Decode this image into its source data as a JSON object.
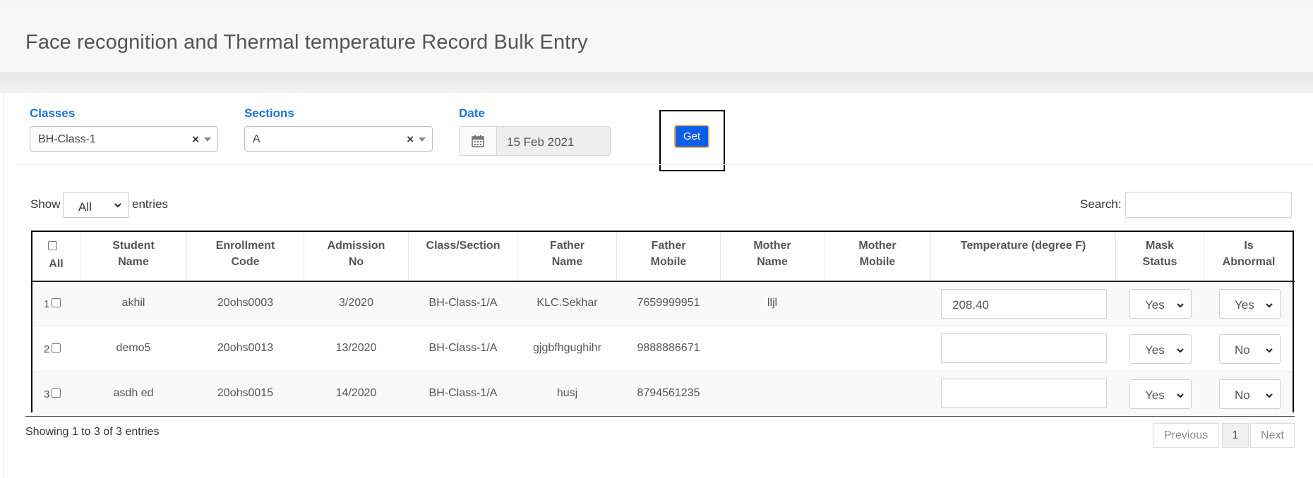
{
  "page": {
    "title": "Face recognition and Thermal temperature Record Bulk Entry"
  },
  "filters": {
    "classes": {
      "label": "Classes",
      "value": "BH-Class-1",
      "clear": "×"
    },
    "sections": {
      "label": "Sections",
      "value": "A",
      "clear": "×"
    },
    "date": {
      "label": "Date",
      "value": "15 Feb 2021"
    },
    "get_label": "Get"
  },
  "table_controls": {
    "show_label": "Show",
    "entries_value": "All",
    "entries_label": "entries",
    "search_label": "Search:",
    "search_value": ""
  },
  "columns": {
    "all": "All",
    "student_name": [
      "Student",
      "Name"
    ],
    "enrollment_code": [
      "Enrollment",
      "Code"
    ],
    "admission_no": [
      "Admission",
      "No"
    ],
    "class_section": "Class/Section",
    "father_name": [
      "Father",
      "Name"
    ],
    "father_mobile": [
      "Father",
      "Mobile"
    ],
    "mother_name": [
      "Mother",
      "Name"
    ],
    "mother_mobile": [
      "Mother",
      "Mobile"
    ],
    "temperature": "Temperature (degree F)",
    "mask_status": [
      "Mask",
      "Status"
    ],
    "is_abnormal": [
      "Is",
      "Abnormal"
    ]
  },
  "rows": [
    {
      "num": "1",
      "student_name": "akhil",
      "enrollment_code": "20ohs0003",
      "admission_no": "3/2020",
      "class_section": "BH-Class-1/A",
      "father_name": "KLC.Sekhar",
      "father_mobile": "7659999951",
      "mother_name": "lljl",
      "mother_mobile": "",
      "temperature": "208.40",
      "mask_status": "Yes",
      "is_abnormal": "Yes"
    },
    {
      "num": "2",
      "student_name": "demo5",
      "enrollment_code": "20ohs0013",
      "admission_no": "13/2020",
      "class_section": "BH-Class-1/A",
      "father_name": "gjgbfhgughihr",
      "father_mobile": "9888886671",
      "mother_name": "",
      "mother_mobile": "",
      "temperature": "",
      "mask_status": "Yes",
      "is_abnormal": "No"
    },
    {
      "num": "3",
      "student_name": "asdh ed",
      "enrollment_code": "20ohs0015",
      "admission_no": "14/2020",
      "class_section": "BH-Class-1/A",
      "father_name": "husj",
      "father_mobile": "8794561235",
      "mother_name": "",
      "mother_mobile": "",
      "temperature": "",
      "mask_status": "Yes",
      "is_abnormal": "No"
    }
  ],
  "footer": {
    "info": "Showing 1 to 3 of 3 entries",
    "previous": "Previous",
    "page": "1",
    "next": "Next"
  }
}
